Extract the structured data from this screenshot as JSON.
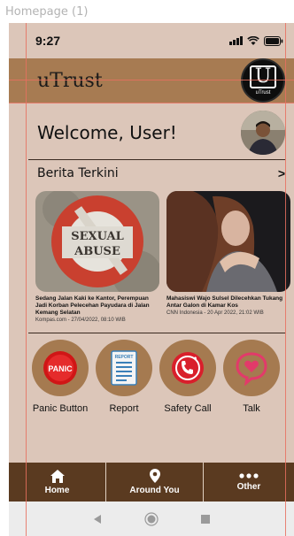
{
  "frame": {
    "label": "Homepage (1)"
  },
  "status_bar": {
    "time": "9:27"
  },
  "header": {
    "app_title": "uTrust",
    "logo_letter": "U",
    "logo_caption": "uTrust"
  },
  "welcome": {
    "text": "Welcome, User!"
  },
  "news": {
    "section_title": "Berita Terkini",
    "more_label": ">",
    "stamp_text_1": "SEXUAL",
    "stamp_text_2": "ABUSE",
    "items": [
      {
        "headline": "Sedang Jalan Kaki ke Kantor, Perempuan Jadi Korban Pelecehan Payudara di Jalan Kemang Selatan",
        "source": "Kompas.com - 27/04/2022, 08:10 WIB"
      },
      {
        "headline": "Mahasiswi Wajo Sulsel Dilecehkan Tukang Antar Galon di Kamar Kos",
        "source": "CNN Indonesia - 20 Apr 2022, 21:02 WIB"
      }
    ]
  },
  "actions": [
    {
      "label": "Panic Button",
      "icon": "panic-icon",
      "icon_text": "PANIC"
    },
    {
      "label": "Report",
      "icon": "report-icon",
      "icon_text": "REPORT"
    },
    {
      "label": "Safety Call",
      "icon": "safety-call-icon"
    },
    {
      "label": "Talk",
      "icon": "talk-icon"
    }
  ],
  "bottom_nav": [
    {
      "label": "Home",
      "icon": "home-icon"
    },
    {
      "label": "Around You",
      "icon": "location-pin-icon"
    },
    {
      "label": "Other",
      "icon": "more-dots-icon"
    }
  ],
  "colors": {
    "background": "#dcc6b9",
    "header": "#a77b52",
    "action_circle": "#a57a50",
    "bottom_nav": "#5a3a20"
  }
}
